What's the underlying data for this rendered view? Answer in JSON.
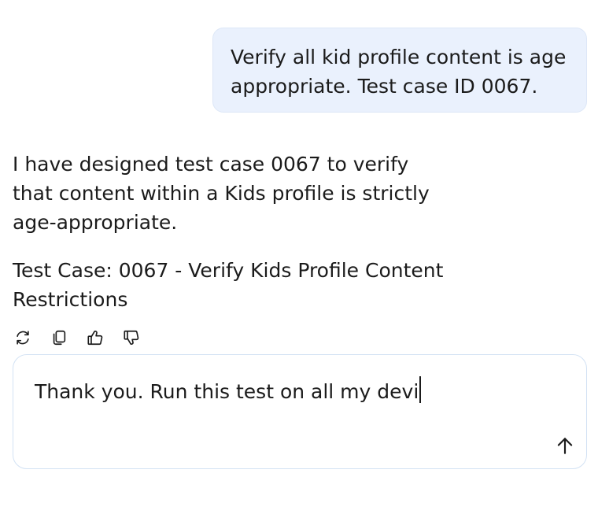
{
  "conversation": {
    "user_message": {
      "line1": "Verify all kid profile content is age",
      "line2": "appropriate. Test case ID 0067."
    },
    "assistant_message": {
      "paragraph1": {
        "line1": "I have designed test case 0067 to verify",
        "line2": "that content within a Kids profile is strictly",
        "line3": "age-appropriate."
      },
      "paragraph2": {
        "line1": "Test Case: 0067 - Verify Kids Profile Content",
        "line2": "Restrictions"
      }
    },
    "message_actions": [
      {
        "icon": "regenerate-icon"
      },
      {
        "icon": "copy-icon"
      },
      {
        "icon": "thumbs-up-icon"
      },
      {
        "icon": "thumbs-down-icon"
      }
    ]
  },
  "composer": {
    "value": "Thank you. Run this test on all my devi",
    "send_icon": "arrow-up-icon"
  },
  "colors": {
    "user_bubble_bg": "#eaf1fd",
    "composer_border": "#d3e2f4",
    "text": "#1b1b1b"
  }
}
